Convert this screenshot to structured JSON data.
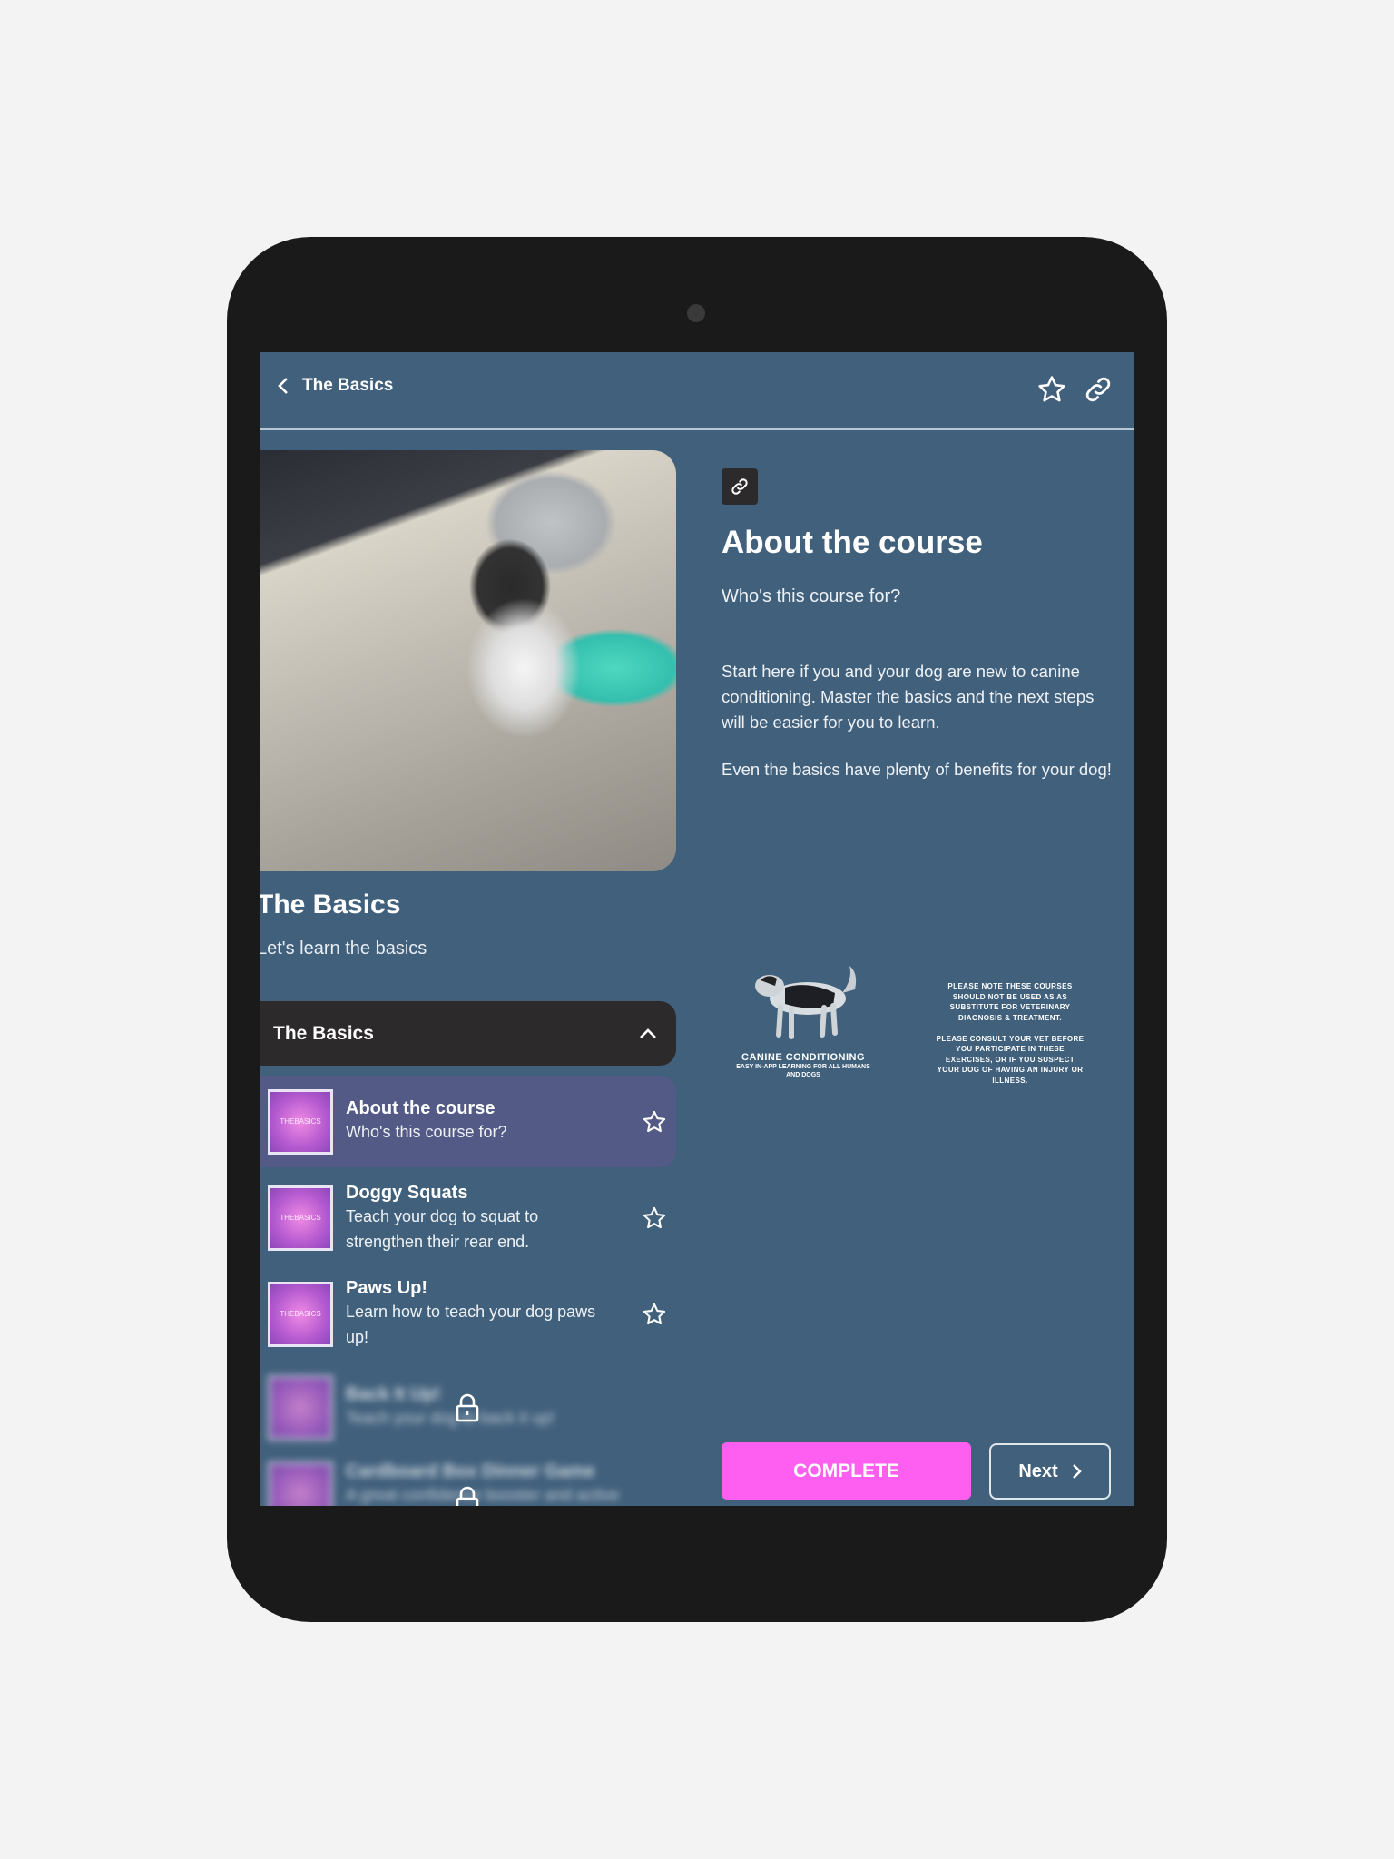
{
  "header": {
    "title": "The Basics",
    "icons": [
      "chevron-left-icon",
      "star-icon",
      "link-icon"
    ]
  },
  "course": {
    "title": "The Basics",
    "subtitle": "Let's learn the basics"
  },
  "accordion": {
    "title": "The Basics",
    "expanded": true
  },
  "thumb_label": [
    "THE",
    "BASICS"
  ],
  "lessons": [
    {
      "title": "About the course",
      "subtitle": "Who's this course for?",
      "selected": true,
      "locked": false
    },
    {
      "title": "Doggy Squats",
      "subtitle": "Teach your dog to squat to strengthen their rear end.",
      "locked": false
    },
    {
      "title": "Paws Up!",
      "subtitle": "Learn how to teach your dog paws up!",
      "locked": false
    },
    {
      "title": "Back It Up!",
      "subtitle": "Teach your dog to back it up!",
      "locked": true
    },
    {
      "title": "Cardboard Box Dinner Game",
      "subtitle": "A great confidence booster and active",
      "locked": true
    }
  ],
  "content": {
    "title": "About the course",
    "subtitle": "Who's this course for?",
    "paragraphs": [
      "Start here if you and your dog are new to canine conditioning. Master the basics and the next steps will be easier for you to learn.",
      "Even the basics have plenty of benefits for your dog!"
    ]
  },
  "logo": {
    "name": "CANINE CONDITIONING",
    "tagline": "EASY IN-APP LEARNING FOR ALL HUMANS AND DOGS"
  },
  "disclaimer": {
    "p1": "PLEASE NOTE THESE COURSES SHOULD NOT BE USED AS AS SUBSTITUTE FOR VETERINARY DIAGNOSIS & TREATMENT.",
    "p2": "PLEASE CONSULT YOUR VET BEFORE YOU PARTICIPATE IN THESE EXERCISES, OR IF YOU SUSPECT YOUR DOG OF HAVING AN INJURY OR ILLNESS."
  },
  "buttons": {
    "complete": "COMPLETE",
    "next": "Next"
  },
  "colors": {
    "screen": "#41607c",
    "accent": "#ff5ff0",
    "selected": "#525a85",
    "accordion": "#2c2a2b"
  }
}
